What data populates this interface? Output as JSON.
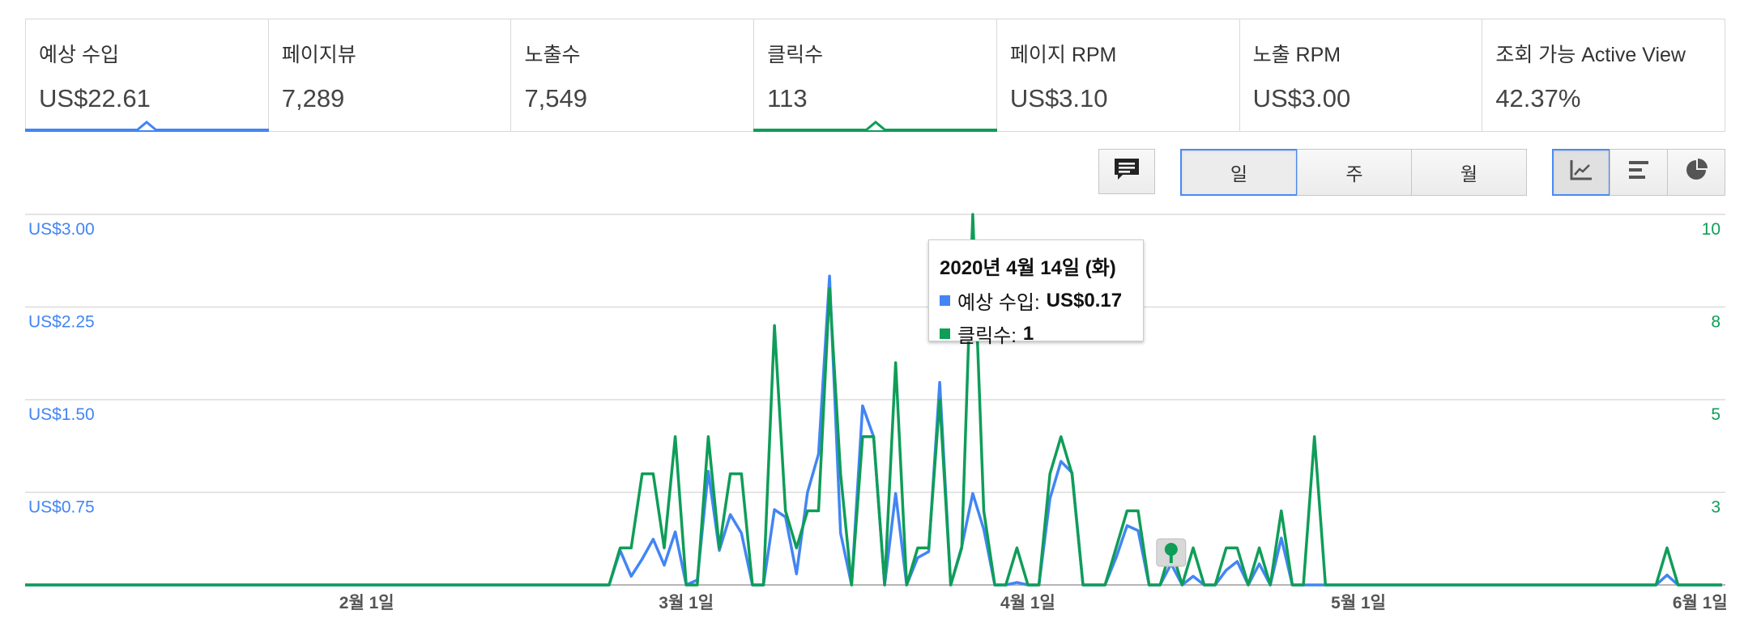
{
  "metrics": [
    {
      "label": "예상 수입",
      "value": "US$22.61",
      "selected": true,
      "color": "#4285f4"
    },
    {
      "label": "페이지뷰",
      "value": "7,289",
      "selected": false
    },
    {
      "label": "노출수",
      "value": "7,549",
      "selected": false
    },
    {
      "label": "클릭수",
      "value": "113",
      "selected": true,
      "color": "#0f9d58"
    },
    {
      "label": "페이지 RPM",
      "value": "US$3.10",
      "selected": false
    },
    {
      "label": "노출 RPM",
      "value": "US$3.00",
      "selected": false
    },
    {
      "label": "조회 가능 Active View",
      "value": "42.37%",
      "selected": false
    }
  ],
  "toolbar": {
    "annotation_icon": "comment-icon",
    "periods": [
      {
        "label": "일",
        "active": true
      },
      {
        "label": "주",
        "active": false
      },
      {
        "label": "월",
        "active": false
      }
    ],
    "chart_types": [
      {
        "icon": "line-chart-icon",
        "active": true
      },
      {
        "icon": "bar-chart-icon",
        "active": false
      },
      {
        "icon": "pie-chart-icon",
        "active": false
      }
    ]
  },
  "tooltip": {
    "date": "2020년 4월 14일 (화)",
    "rows": [
      {
        "label": "예상 수입:",
        "value": "US$0.17",
        "color": "#4285f4"
      },
      {
        "label": "클릭수:",
        "value": "1",
        "color": "#0f9d58"
      }
    ]
  },
  "chart_data": {
    "type": "line",
    "left_axis_ticks": [
      "US$3.00",
      "US$2.25",
      "US$1.50",
      "US$0.75"
    ],
    "right_axis_ticks": [
      "10",
      "8",
      "5",
      "3"
    ],
    "left_ylim": [
      0,
      3.0
    ],
    "right_ylim": [
      0,
      10
    ],
    "x_tick_labels": [
      "2월 1일",
      "3월 1일",
      "4월 1일",
      "5월 1일",
      "6월 1일"
    ],
    "x_range": [
      "2020-01-01",
      "2020-06-03"
    ],
    "x_ticks": [
      "2020-02-01",
      "2020-03-01",
      "2020-04-01",
      "2020-05-01",
      "2020-06-01"
    ],
    "grid": true,
    "marker": {
      "date": "2020-04-14",
      "icon": "annotation-pin-icon"
    },
    "series": [
      {
        "name": "예상 수입",
        "axis": "left",
        "color": "#4285f4",
        "points": [
          [
            "2020-01-01",
            0
          ],
          [
            "2020-02-23",
            0
          ],
          [
            "2020-02-24",
            0.28
          ],
          [
            "2020-02-25",
            0.07
          ],
          [
            "2020-02-26",
            0.21
          ],
          [
            "2020-02-27",
            0.37
          ],
          [
            "2020-02-28",
            0.16
          ],
          [
            "2020-02-29",
            0.43
          ],
          [
            "2020-03-01",
            0
          ],
          [
            "2020-03-02",
            0.04
          ],
          [
            "2020-03-03",
            0.92
          ],
          [
            "2020-03-04",
            0.28
          ],
          [
            "2020-03-05",
            0.57
          ],
          [
            "2020-03-06",
            0.42
          ],
          [
            "2020-03-07",
            0
          ],
          [
            "2020-03-08",
            0
          ],
          [
            "2020-03-09",
            0.61
          ],
          [
            "2020-03-10",
            0.55
          ],
          [
            "2020-03-11",
            0.09
          ],
          [
            "2020-03-12",
            0.75
          ],
          [
            "2020-03-13",
            1.06
          ],
          [
            "2020-03-14",
            2.5
          ],
          [
            "2020-03-15",
            0.42
          ],
          [
            "2020-03-16",
            0
          ],
          [
            "2020-03-17",
            1.45
          ],
          [
            "2020-03-18",
            1.2
          ],
          [
            "2020-03-19",
            0
          ],
          [
            "2020-03-20",
            0.74
          ],
          [
            "2020-03-21",
            0
          ],
          [
            "2020-03-22",
            0.22
          ],
          [
            "2020-03-23",
            0.27
          ],
          [
            "2020-03-24",
            1.64
          ],
          [
            "2020-03-25",
            0
          ],
          [
            "2020-03-26",
            0.31
          ],
          [
            "2020-03-27",
            0.74
          ],
          [
            "2020-03-28",
            0.45
          ],
          [
            "2020-03-29",
            0
          ],
          [
            "2020-03-30",
            0
          ],
          [
            "2020-03-31",
            0.02
          ],
          [
            "2020-04-01",
            0
          ],
          [
            "2020-04-02",
            0
          ],
          [
            "2020-04-03",
            0.7
          ],
          [
            "2020-04-04",
            1.0
          ],
          [
            "2020-04-05",
            0.91
          ],
          [
            "2020-04-06",
            0
          ],
          [
            "2020-04-08",
            0
          ],
          [
            "2020-04-09",
            0.22
          ],
          [
            "2020-04-10",
            0.48
          ],
          [
            "2020-04-11",
            0.44
          ],
          [
            "2020-04-12",
            0
          ],
          [
            "2020-04-13",
            0
          ],
          [
            "2020-04-14",
            0.17
          ],
          [
            "2020-04-15",
            0
          ],
          [
            "2020-04-16",
            0.07
          ],
          [
            "2020-04-17",
            0
          ],
          [
            "2020-04-18",
            0
          ],
          [
            "2020-04-19",
            0.12
          ],
          [
            "2020-04-20",
            0.19
          ],
          [
            "2020-04-21",
            0
          ],
          [
            "2020-04-22",
            0.17
          ],
          [
            "2020-04-23",
            0
          ],
          [
            "2020-04-24",
            0.38
          ],
          [
            "2020-04-25",
            0
          ],
          [
            "2020-04-26",
            0
          ],
          [
            "2020-04-27",
            0
          ],
          [
            "2020-05-28",
            0
          ],
          [
            "2020-05-29",
            0.08
          ],
          [
            "2020-05-30",
            0
          ],
          [
            "2020-06-03",
            0
          ]
        ]
      },
      {
        "name": "클릭수",
        "axis": "right",
        "color": "#0f9d58",
        "points": [
          [
            "2020-01-01",
            0
          ],
          [
            "2020-02-23",
            0
          ],
          [
            "2020-02-24",
            1
          ],
          [
            "2020-02-25",
            1
          ],
          [
            "2020-02-26",
            3
          ],
          [
            "2020-02-27",
            3
          ],
          [
            "2020-02-28",
            1
          ],
          [
            "2020-02-29",
            4
          ],
          [
            "2020-03-01",
            0
          ],
          [
            "2020-03-02",
            0
          ],
          [
            "2020-03-03",
            4
          ],
          [
            "2020-03-04",
            1
          ],
          [
            "2020-03-05",
            3
          ],
          [
            "2020-03-06",
            3
          ],
          [
            "2020-03-07",
            0
          ],
          [
            "2020-03-08",
            0
          ],
          [
            "2020-03-09",
            7
          ],
          [
            "2020-03-10",
            2
          ],
          [
            "2020-03-11",
            1
          ],
          [
            "2020-03-12",
            2
          ],
          [
            "2020-03-13",
            2
          ],
          [
            "2020-03-14",
            8
          ],
          [
            "2020-03-15",
            3
          ],
          [
            "2020-03-16",
            0
          ],
          [
            "2020-03-17",
            4
          ],
          [
            "2020-03-18",
            4
          ],
          [
            "2020-03-19",
            0
          ],
          [
            "2020-03-20",
            6
          ],
          [
            "2020-03-21",
            0
          ],
          [
            "2020-03-22",
            1
          ],
          [
            "2020-03-23",
            1
          ],
          [
            "2020-03-24",
            5
          ],
          [
            "2020-03-25",
            0
          ],
          [
            "2020-03-26",
            1
          ],
          [
            "2020-03-27",
            10
          ],
          [
            "2020-03-28",
            2
          ],
          [
            "2020-03-29",
            0
          ],
          [
            "2020-03-30",
            0
          ],
          [
            "2020-03-31",
            1
          ],
          [
            "2020-04-01",
            0
          ],
          [
            "2020-04-02",
            0
          ],
          [
            "2020-04-03",
            3
          ],
          [
            "2020-04-04",
            4
          ],
          [
            "2020-04-05",
            3
          ],
          [
            "2020-04-06",
            0
          ],
          [
            "2020-04-08",
            0
          ],
          [
            "2020-04-09",
            1
          ],
          [
            "2020-04-10",
            2
          ],
          [
            "2020-04-11",
            2
          ],
          [
            "2020-04-12",
            0
          ],
          [
            "2020-04-13",
            0
          ],
          [
            "2020-04-14",
            1
          ],
          [
            "2020-04-15",
            0
          ],
          [
            "2020-04-16",
            1
          ],
          [
            "2020-04-17",
            0
          ],
          [
            "2020-04-18",
            0
          ],
          [
            "2020-04-19",
            1
          ],
          [
            "2020-04-20",
            1
          ],
          [
            "2020-04-21",
            0
          ],
          [
            "2020-04-22",
            1
          ],
          [
            "2020-04-23",
            0
          ],
          [
            "2020-04-24",
            2
          ],
          [
            "2020-04-25",
            0
          ],
          [
            "2020-04-26",
            0
          ],
          [
            "2020-04-27",
            4
          ],
          [
            "2020-04-28",
            0
          ],
          [
            "2020-05-28",
            0
          ],
          [
            "2020-05-29",
            1
          ],
          [
            "2020-05-30",
            0
          ],
          [
            "2020-06-03",
            0
          ]
        ]
      }
    ]
  }
}
